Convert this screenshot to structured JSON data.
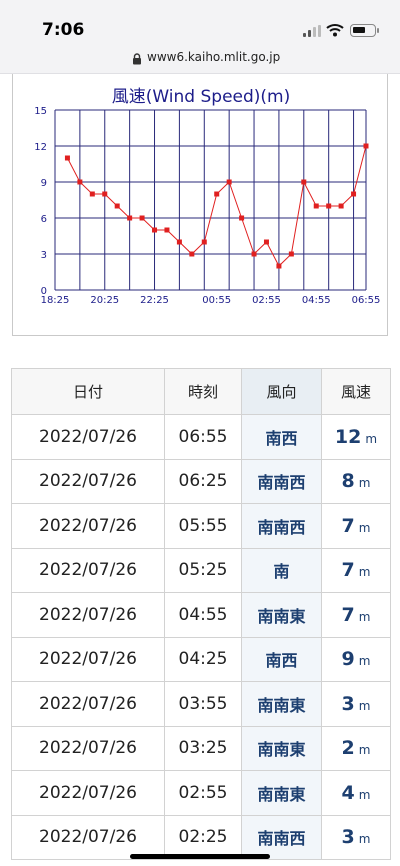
{
  "status_bar": {
    "time": "7:06"
  },
  "browser": {
    "url": "www6.kaiho.mlit.go.jp"
  },
  "chart_data": {
    "type": "line",
    "title": "風速(Wind Speed)(m)",
    "x": [
      "18:25",
      "18:55",
      "19:25",
      "19:55",
      "20:25",
      "20:55",
      "21:25",
      "21:55",
      "22:25",
      "22:55",
      "23:25",
      "23:55",
      "00:25",
      "00:55",
      "01:25",
      "01:55",
      "02:25",
      "02:55",
      "03:25",
      "03:55",
      "04:25",
      "04:55",
      "05:25",
      "05:55",
      "06:25",
      "06:55"
    ],
    "x_tick_labels": [
      "18:25",
      "20:25",
      "22:25",
      "00:55",
      "02:55",
      "04:55",
      "06:55"
    ],
    "series": [
      {
        "values": [
          11,
          9,
          8,
          8,
          7,
          6,
          6,
          5,
          5,
          4,
          3,
          4,
          8,
          9,
          6,
          3,
          4,
          2,
          3,
          9,
          7,
          7,
          7,
          8,
          12
        ]
      }
    ],
    "ylim": [
      0,
      15
    ],
    "y_ticks": [
      0,
      3,
      6,
      9,
      12,
      15
    ],
    "grid": true,
    "colors": {
      "line": "#e02020",
      "marker": "#e02020",
      "grid": "#2a2a7a",
      "title": "#1d1d8a",
      "ticks": "#1d1d8a"
    }
  },
  "table": {
    "headers": {
      "date": "日付",
      "time": "時刻",
      "direction": "風向",
      "speed": "風速"
    },
    "unit": "m",
    "rows": [
      {
        "date": "2022/07/26",
        "time": "06:55",
        "direction": "南西",
        "speed": "12"
      },
      {
        "date": "2022/07/26",
        "time": "06:25",
        "direction": "南南西",
        "speed": "8"
      },
      {
        "date": "2022/07/26",
        "time": "05:55",
        "direction": "南南西",
        "speed": "7"
      },
      {
        "date": "2022/07/26",
        "time": "05:25",
        "direction": "南",
        "speed": "7"
      },
      {
        "date": "2022/07/26",
        "time": "04:55",
        "direction": "南南東",
        "speed": "7"
      },
      {
        "date": "2022/07/26",
        "time": "04:25",
        "direction": "南西",
        "speed": "9"
      },
      {
        "date": "2022/07/26",
        "time": "03:55",
        "direction": "南南東",
        "speed": "3"
      },
      {
        "date": "2022/07/26",
        "time": "03:25",
        "direction": "南南東",
        "speed": "2"
      },
      {
        "date": "2022/07/26",
        "time": "02:55",
        "direction": "南南東",
        "speed": "4"
      },
      {
        "date": "2022/07/26",
        "time": "02:25",
        "direction": "南南西",
        "speed": "3"
      }
    ]
  }
}
